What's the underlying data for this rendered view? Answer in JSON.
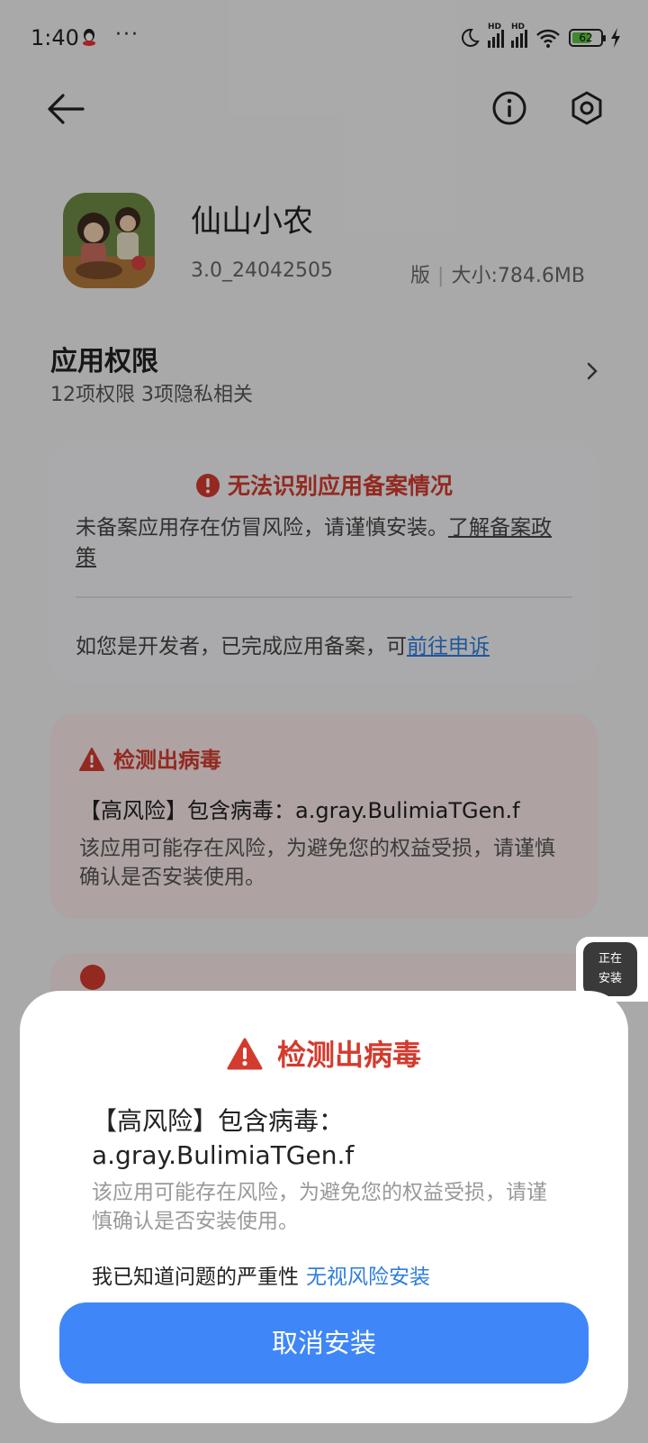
{
  "status_bar": {
    "time": "1:40",
    "more": "···",
    "battery": "62"
  },
  "app": {
    "name": "仙山小农",
    "version": "3.0_24042505",
    "version_suffix": "版",
    "size": "大小:784.6MB"
  },
  "permissions": {
    "title": "应用权限",
    "summary": "12项权限 3项隐私相关"
  },
  "filing_card": {
    "title": "无法识别应用备案情况",
    "body": "未备案应用存在仿冒风险，请谨慎安装。",
    "policy_link": "了解备案政策",
    "footer": "如您是开发者，已完成应用备案，可",
    "appeal_link": "前往申诉"
  },
  "virus_card": {
    "title": "检测出病毒",
    "risk": "【高风险】包含病毒：a.gray.BulimiaTGen.f",
    "body": "该应用可能存在风险，为避免您的权益受损，请谨慎确认是否安装使用。"
  },
  "floating_widget": {
    "line1": "正在",
    "line2": "安装"
  },
  "dialog": {
    "title": "检测出病毒",
    "risk_line1": "【高风险】包含病毒：",
    "risk_line2": "a.gray.BulimiaTGen.f",
    "body": "该应用可能存在风险，为避免您的权益受损，请谨慎确认是否安装使用。",
    "ack": "我已知道问题的严重性",
    "ignore_link": "无视风险安装",
    "cancel_button": "取消安装"
  },
  "colors": {
    "danger": "#d33b2e",
    "link": "#2f7ddf",
    "primary_button": "#3f86f8"
  }
}
